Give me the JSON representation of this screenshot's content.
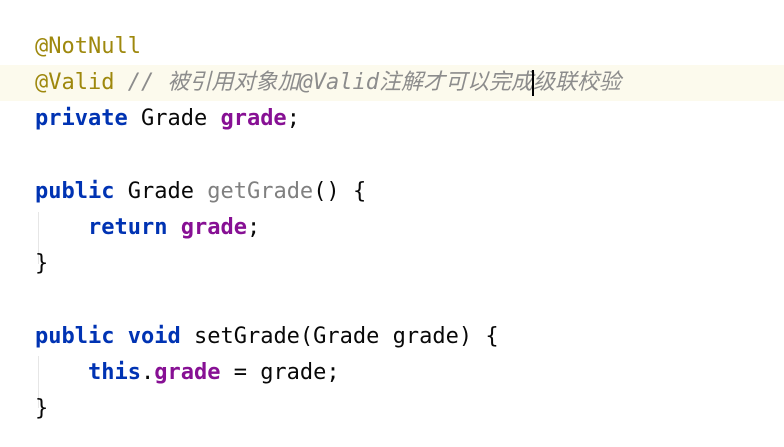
{
  "editor": {
    "lines": [
      {
        "tokens": [
          "@NotNull"
        ]
      },
      {
        "tokens": [
          "@Valid",
          " ",
          "// 被引用对象加@Valid注解才可以完成",
          "级联校验"
        ]
      },
      {
        "tokens": [
          "private",
          " ",
          "Grade",
          " ",
          "grade",
          ";"
        ]
      },
      {
        "tokens": []
      },
      {
        "tokens": [
          "public",
          " ",
          "Grade",
          " ",
          "getGrade",
          "()",
          " ",
          "{"
        ]
      },
      {
        "tokens": [
          "    ",
          "return",
          " ",
          "grade",
          ";"
        ]
      },
      {
        "tokens": [
          "}"
        ]
      },
      {
        "tokens": []
      },
      {
        "tokens": [
          "public",
          " ",
          "void",
          " ",
          "setGrade(Grade grade)",
          " ",
          "{"
        ]
      },
      {
        "tokens": [
          "    ",
          "this",
          ".",
          "grade",
          " = grade;"
        ]
      },
      {
        "tokens": [
          "}"
        ]
      }
    ]
  },
  "colors": {
    "background": "#ffffff",
    "current_line": "#fcfaed",
    "keyword": "#0033b3",
    "annotation": "#9e880d",
    "field": "#871094",
    "comment": "#8c8c8c",
    "unused_method": "#808080",
    "text": "#080808"
  }
}
